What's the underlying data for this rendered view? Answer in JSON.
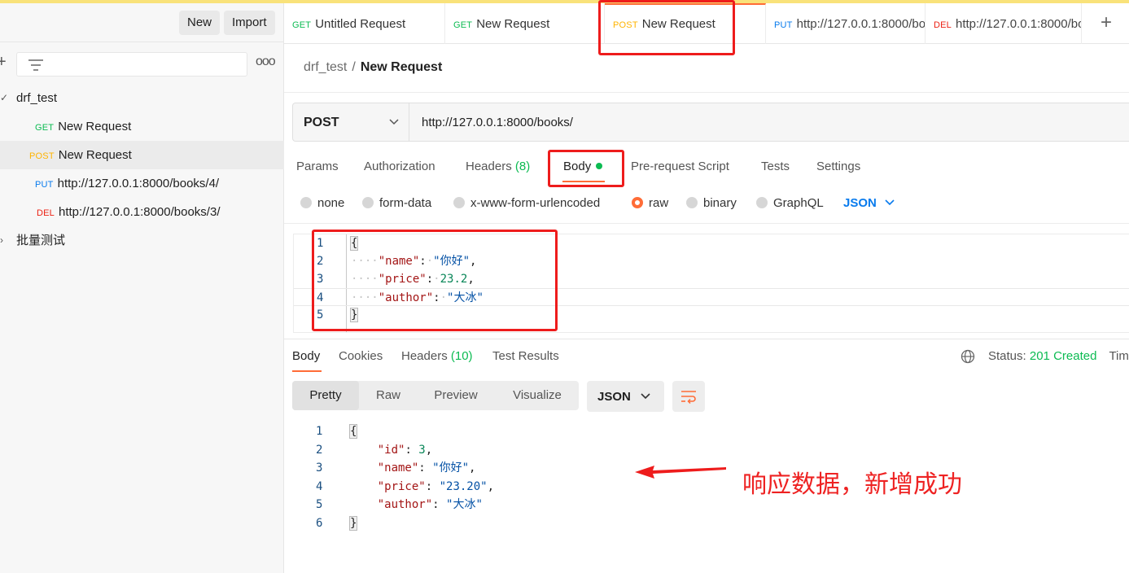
{
  "sidebar": {
    "new_label": "New",
    "import_label": "Import",
    "more": "ooo",
    "collection": "drf_test",
    "items": [
      {
        "method": "GET",
        "label": "New Request"
      },
      {
        "method": "POST",
        "label": "New Request"
      },
      {
        "method": "PUT",
        "label": "http://127.0.0.1:8000/books/4/"
      },
      {
        "method": "DEL",
        "label": "http://127.0.0.1:8000/books/3/"
      }
    ],
    "folder2": "批量测试"
  },
  "tabs": [
    {
      "method": "GET",
      "label": "Untitled Request"
    },
    {
      "method": "GET",
      "label": "New Request"
    },
    {
      "method": "POST",
      "label": "New Request"
    },
    {
      "method": "PUT",
      "label": "http://127.0.0.1:8000/bo"
    },
    {
      "method": "DEL",
      "label": "http://127.0.0.1:8000/bo"
    }
  ],
  "breadcrumb": {
    "collection": "drf_test",
    "sep": "/",
    "request": "New Request"
  },
  "request": {
    "method": "POST",
    "url": "http://127.0.0.1:8000/books/"
  },
  "req_tabs": {
    "params": "Params",
    "authorization": "Authorization",
    "headers": "Headers",
    "headers_count": "(8)",
    "body": "Body",
    "prerequest": "Pre-request Script",
    "tests": "Tests",
    "settings": "Settings"
  },
  "body_types": {
    "none": "none",
    "form_data": "form-data",
    "urlencoded": "x-www-form-urlencoded",
    "raw": "raw",
    "binary": "binary",
    "graphql": "GraphQL",
    "format": "JSON"
  },
  "request_body": {
    "ln": [
      "1",
      "2",
      "3",
      "4",
      "5"
    ],
    "open": "{",
    "close": "}",
    "name_key": "\"name\"",
    "name_val": "\"你好\"",
    "price_key": "\"price\"",
    "price_val": "23.2",
    "author_key": "\"author\"",
    "author_val": "\"大冰\""
  },
  "resp_tabs": {
    "body": "Body",
    "cookies": "Cookies",
    "headers": "Headers",
    "headers_count": "(10)",
    "test_results": "Test Results"
  },
  "status": {
    "label": "Status:",
    "value": "201 Created",
    "time": "Time"
  },
  "view": {
    "pretty": "Pretty",
    "raw": "Raw",
    "preview": "Preview",
    "visualize": "Visualize",
    "format": "JSON"
  },
  "response_body": {
    "ln": [
      "1",
      "2",
      "3",
      "4",
      "5",
      "6"
    ],
    "open": "{",
    "close": "}",
    "id_key": "\"id\"",
    "id_val": "3",
    "name_key": "\"name\"",
    "name_val": "\"你好\"",
    "price_key": "\"price\"",
    "price_val": "\"23.20\"",
    "author_key": "\"author\"",
    "author_val": "\"大冰\""
  },
  "annotation": "响应数据，新增成功",
  "colors": {
    "accent": "#ff6c37",
    "annotation": "#ee1c1c",
    "success": "#0cbb52"
  }
}
